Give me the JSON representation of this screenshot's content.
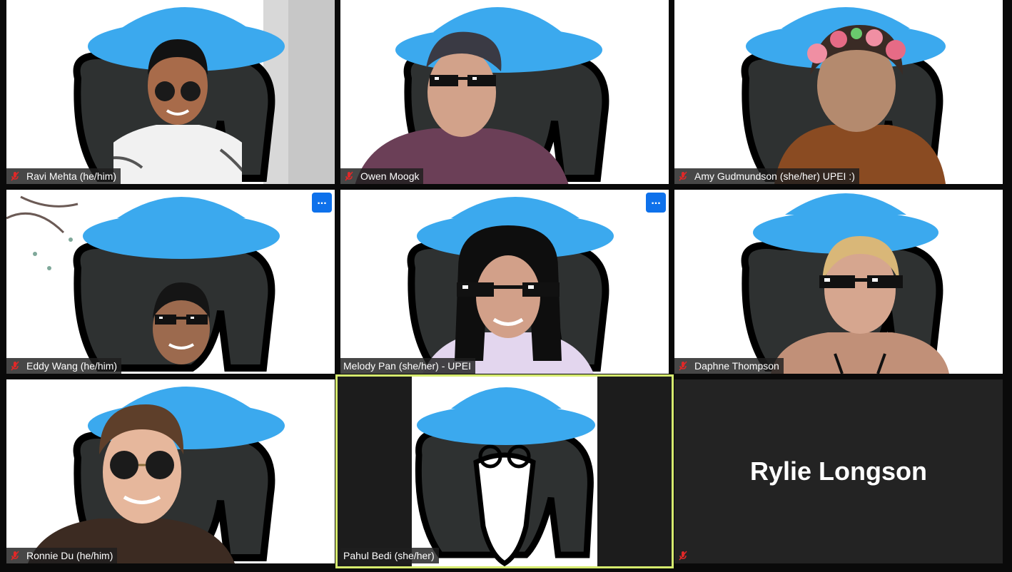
{
  "meeting": {
    "view": "Gallery View",
    "accent_color": "#0e71eb",
    "active_speaker_color": "#d6eb6e",
    "muted_icon_color": "#e02828"
  },
  "participants": [
    {
      "name": "Ravi Mehta (he/him)",
      "muted": true,
      "video": true,
      "glasses": "round"
    },
    {
      "name": "Owen Moogk",
      "muted": true,
      "video": true,
      "glasses": "pixel"
    },
    {
      "name": "Amy Gudmundson (she/her) UPEI :)",
      "muted": true,
      "video": true,
      "glasses": "flower-crown"
    },
    {
      "name": "Eddy Wang (he/him)",
      "muted": true,
      "video": true,
      "glasses": "pixel",
      "more_button": "..."
    },
    {
      "name": "Melody Pan (she/her) - UPEI",
      "muted": false,
      "video": true,
      "glasses": "pixel",
      "more_button": "..."
    },
    {
      "name": "Daphne Thompson",
      "muted": true,
      "video": true,
      "glasses": "pixel"
    },
    {
      "name": "Ronnie Du (he/him)",
      "muted": true,
      "video": true,
      "glasses": "round"
    },
    {
      "name": "Pahul Bedi (she/her)",
      "muted": false,
      "video": true,
      "active_speaker": true
    },
    {
      "name": "Rylie Longson",
      "muted": true,
      "video": false,
      "display_name": "Rylie Longson"
    }
  ],
  "background": {
    "hat_color": "#3ba9ee",
    "elephant_color": "#2e3131"
  }
}
